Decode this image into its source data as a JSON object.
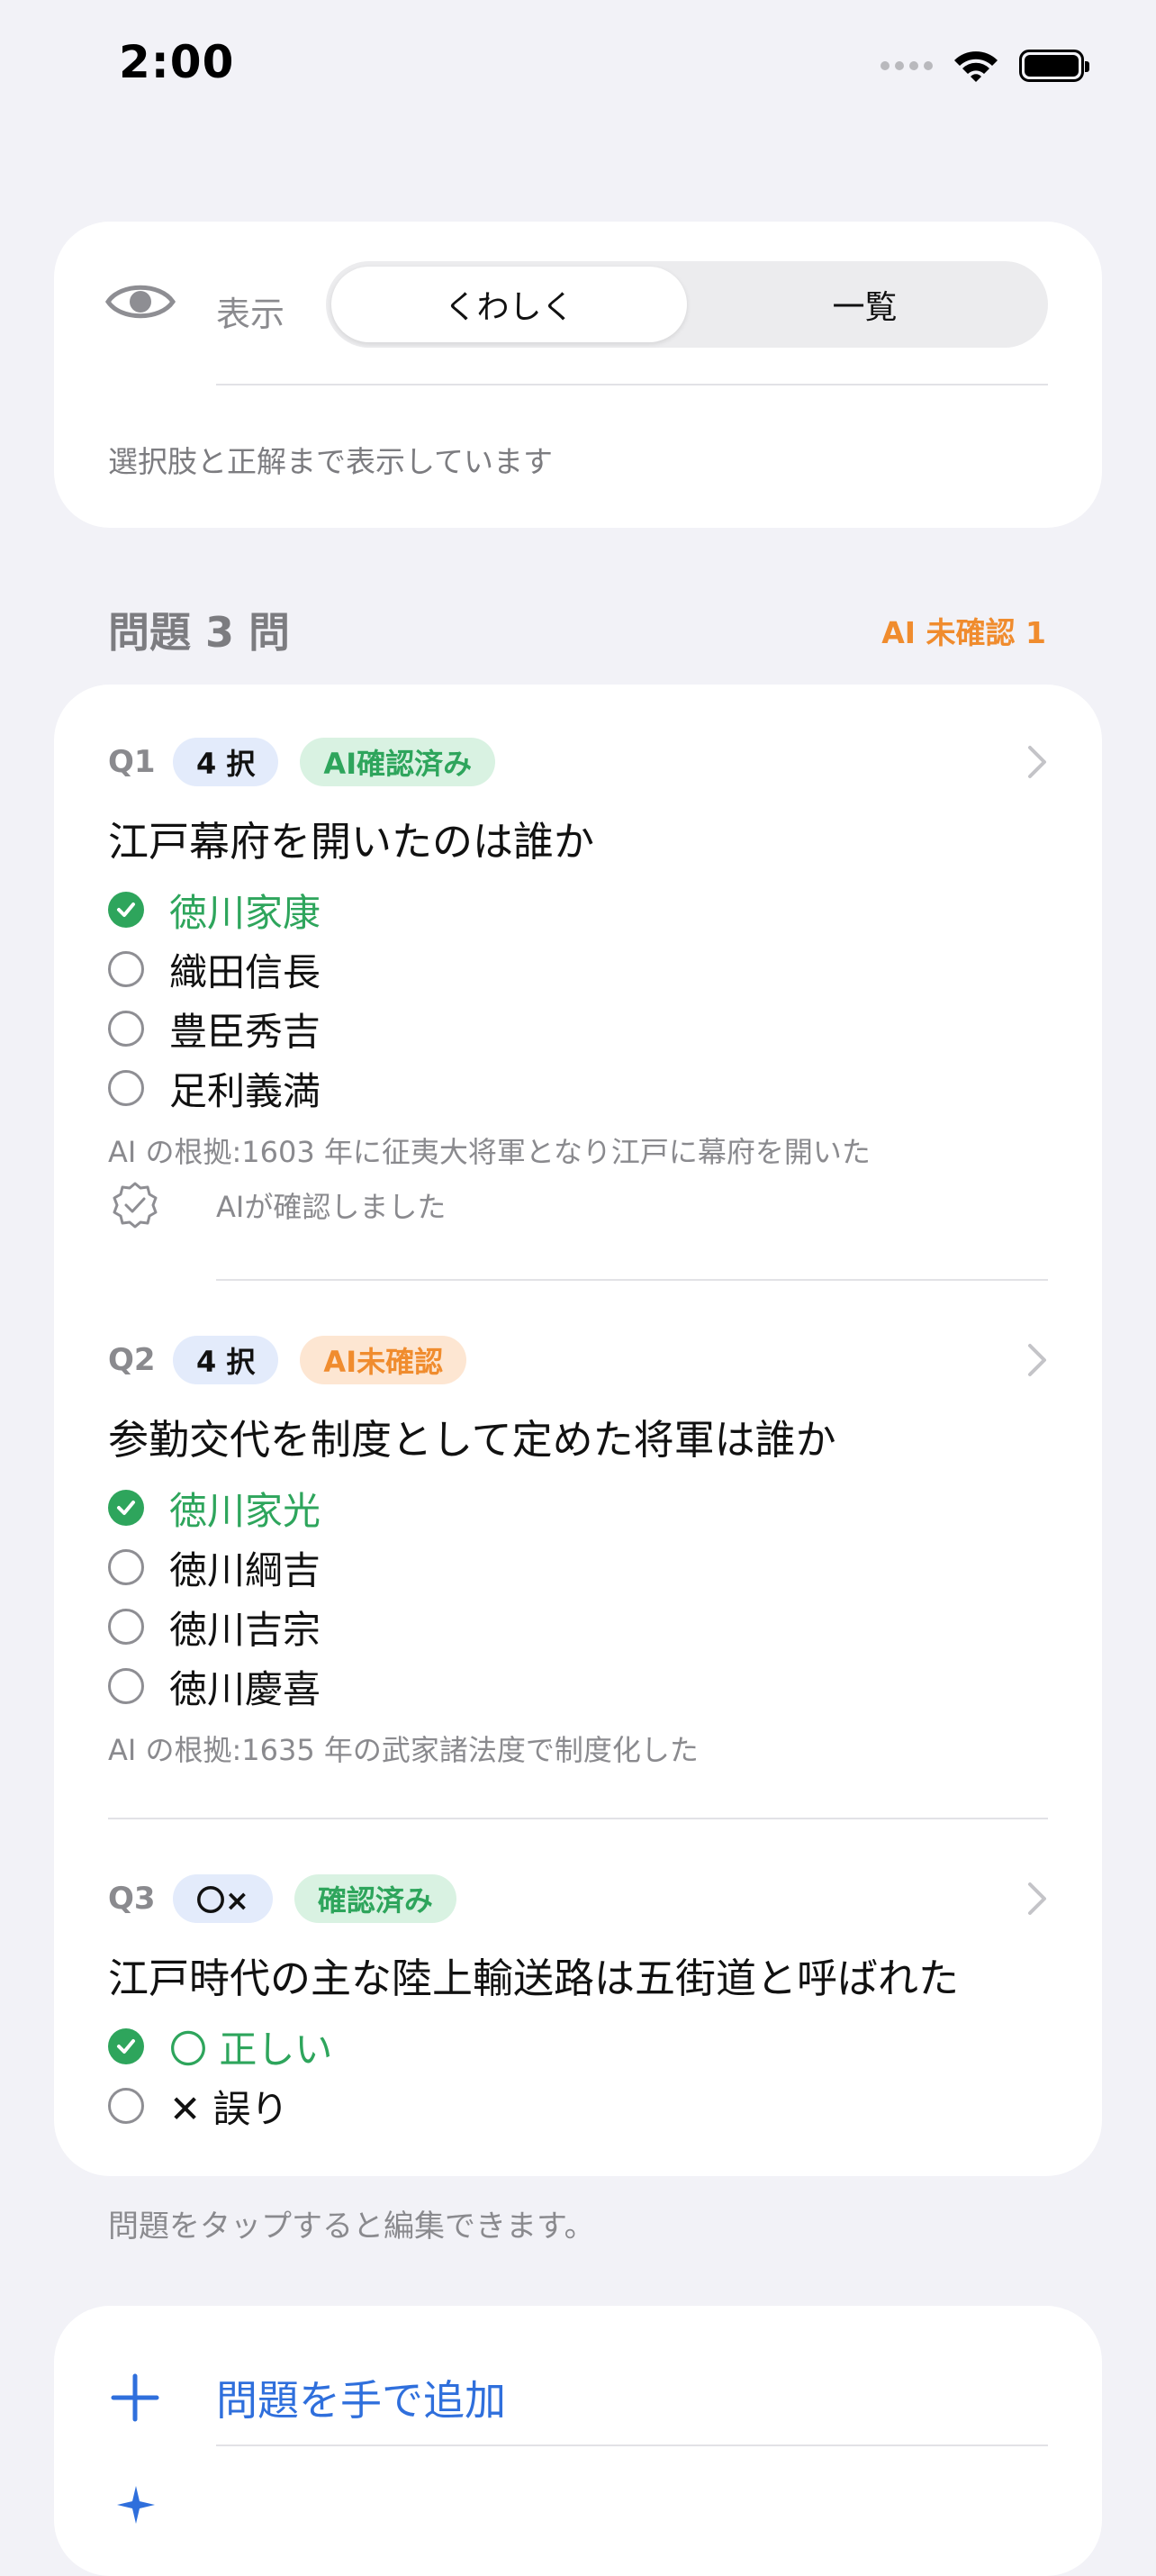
{
  "status": {
    "time": "2:00"
  },
  "display": {
    "label": "表示",
    "options": [
      "くわしく",
      "一覧"
    ],
    "selected": "くわしく",
    "description": "選択肢と正解まで表示しています"
  },
  "section": {
    "title": "問題 3 問",
    "badge": "AI 未確認 1"
  },
  "questions": [
    {
      "number": "Q1",
      "type": "4 択",
      "status": "AI確認済み",
      "title": "江戸幕府を開いたのは誰か",
      "options": [
        {
          "label": "徳川家康",
          "correct": true
        },
        {
          "label": "織田信長",
          "correct": false
        },
        {
          "label": "豊臣秀吉",
          "correct": false
        },
        {
          "label": "足利義満",
          "correct": false
        }
      ],
      "note": "AI の根拠:1603 年に征夷大将軍となり江戸に幕府を開いた",
      "ai_confirmed": "AIが確認しました"
    },
    {
      "number": "Q2",
      "type": "4 択",
      "status": "AI未確認",
      "title": "参勤交代を制度として定めた将軍は誰か",
      "options": [
        {
          "label": "徳川家光",
          "correct": true
        },
        {
          "label": "徳川綱吉",
          "correct": false
        },
        {
          "label": "徳川吉宗",
          "correct": false
        },
        {
          "label": "徳川慶喜",
          "correct": false
        }
      ],
      "note": "AI の根拠:1635 年の武家諸法度で制度化した"
    },
    {
      "number": "Q3",
      "type": "〇×",
      "status": "確認済み",
      "title": "江戸時代の主な陸上輸送路は五街道と呼ばれた",
      "options": [
        {
          "label": "〇 正しい",
          "correct": true
        },
        {
          "label": "✕ 誤り",
          "correct": false
        }
      ]
    }
  ],
  "hint": "問題をタップすると編集できます。",
  "add": {
    "label": "問題を手で追加"
  },
  "colors": {
    "accent_blue": "#2f6fdc",
    "green": "#2ea55c",
    "orange": "#f08c2e"
  }
}
